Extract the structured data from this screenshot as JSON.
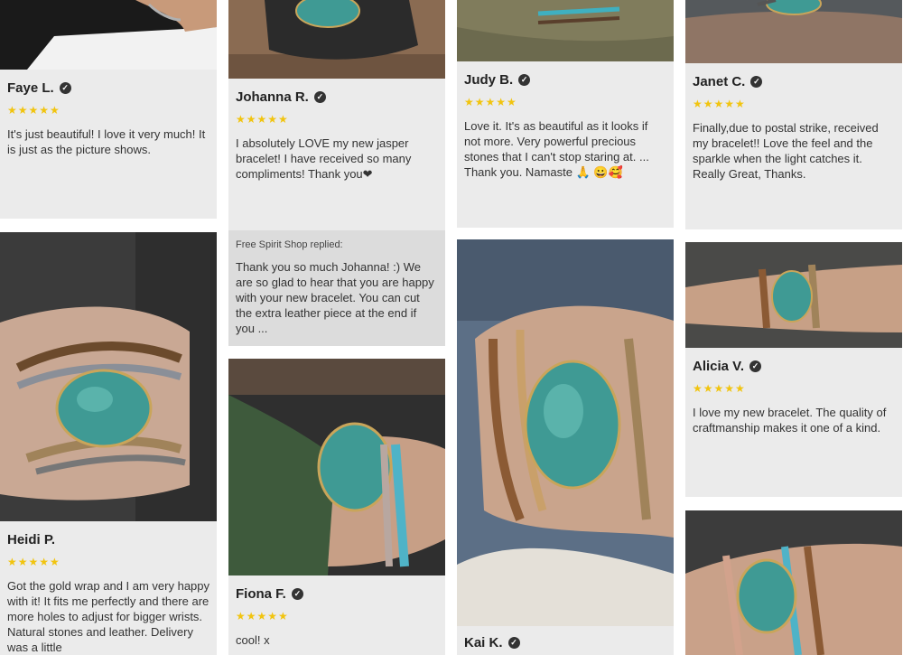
{
  "reviews": {
    "faye": {
      "name": "Faye L.",
      "stars": "★★★★★",
      "text": "It's just beautiful! I love it very much! It is just as the picture shows."
    },
    "heidi": {
      "name": "Heidi P.",
      "stars": "★★★★★",
      "text": "Got the gold wrap and I am very happy with it! It fits me perfectly and there are more holes to adjust for bigger wrists. Natural stones and leather. Delivery was a little"
    },
    "johanna": {
      "name": "Johanna R.",
      "stars": "★★★★★",
      "text": "I absolutely LOVE my new jasper bracelet! I have received so many compliments! Thank you❤"
    },
    "fiona": {
      "name": "Fiona F.",
      "stars": "★★★★★",
      "text": "cool! x"
    },
    "judy": {
      "name": "Judy B.",
      "stars": "★★★★★",
      "text": "Love it. It's as beautiful as it looks if not more. Very powerful precious stones that I can't stop staring at. ... Thank you. Namaste 🙏 😀🥰"
    },
    "kai": {
      "name": "Kai K.",
      "stars": "★★★★★",
      "text": ""
    },
    "janet": {
      "name": "Janet C.",
      "stars": "★★★★★",
      "text": "Finally,due to postal strike, received my bracelet!! Love the feel and the sparkle when the light catches it. Really Great, Thanks."
    },
    "alicia": {
      "name": "Alicia V.",
      "stars": "★★★★★",
      "text": "I love my new bracelet. The quality of craftmanship makes it one of a kind."
    }
  },
  "reply": {
    "label": "Free Spirit Shop replied:",
    "text": "Thank you so much Johanna! :) We are so glad to hear that you are happy with your new bracelet. You can cut the extra leather piece at the end if you ..."
  },
  "verified_icon": "✓",
  "colors": {
    "card": "#ebebeb",
    "reply": "#dcdcdc",
    "star": "#f1c40f",
    "turquoise": "#3f9a94"
  }
}
